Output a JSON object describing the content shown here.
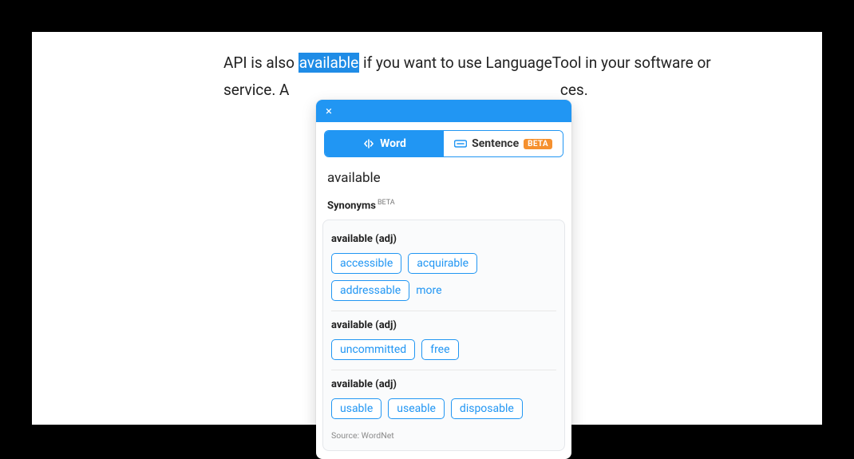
{
  "text": {
    "before": "API is also ",
    "highlight": "available",
    "after_line1": " if you want to use LanguageTool in your software or",
    "line2_pre": "service. A",
    "line2_post": "ces."
  },
  "popup": {
    "tabs": {
      "word": "Word",
      "sentence": "Sentence",
      "beta": "BETA"
    },
    "word": "available",
    "synonyms_label": "Synonyms",
    "synonyms_badge": "BETA",
    "senses": [
      {
        "label": "available (adj)",
        "items": [
          "accessible",
          "acquirable",
          "addressable"
        ],
        "more": "more"
      },
      {
        "label": "available (adj)",
        "items": [
          "uncommitted",
          "free"
        ]
      },
      {
        "label": "available (adj)",
        "items": [
          "usable",
          "useable",
          "disposable"
        ]
      }
    ],
    "source": "Source: WordNet"
  }
}
